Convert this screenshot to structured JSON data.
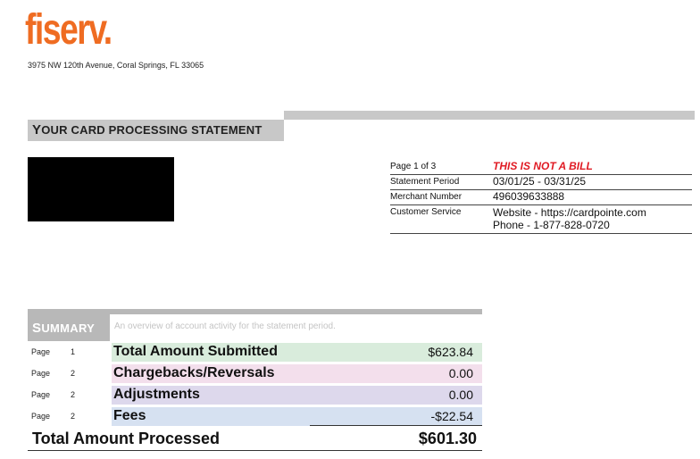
{
  "brand": {
    "logo_text": "fiserv.",
    "logo_color": "#ef6c22"
  },
  "address": "3975 NW 120th Avenue, Coral Springs, FL 33065",
  "statement_title_first": "Y",
  "statement_title_rest": "OUR CARD PROCESSING STATEMENT",
  "info": {
    "page": {
      "label": "Page 1 of 3",
      "value": "THIS IS NOT A BILL"
    },
    "period": {
      "label": "Statement Period",
      "value": "03/01/25 - 03/31/25"
    },
    "merchant": {
      "label": "Merchant Number",
      "value": "496039633888"
    },
    "service": {
      "label": "Customer Service",
      "website": "Website - https://cardpointe.com",
      "phone": "Phone - 1-877-828-0720"
    }
  },
  "summary": {
    "title_first": "S",
    "title_rest": "UMMARY",
    "description": "An overview of account activity for the statement period.",
    "rows": [
      {
        "page_label": "Page",
        "page_num": "1",
        "desc": "Total Amount Submitted",
        "amount": "$623.84",
        "color": "#d9ecdc"
      },
      {
        "page_label": "Page",
        "page_num": "2",
        "desc": "Chargebacks/Reversals",
        "amount": "0.00",
        "color": "#f3dfec"
      },
      {
        "page_label": "Page",
        "page_num": "2",
        "desc": "Adjustments",
        "amount": "0.00",
        "color": "#ddd8ec"
      },
      {
        "page_label": "Page",
        "page_num": "2",
        "desc": "Fees",
        "amount": "-$22.54",
        "color": "#d6e1f1"
      }
    ],
    "total_label": "Total Amount Processed",
    "total_amount": "$601.30"
  }
}
